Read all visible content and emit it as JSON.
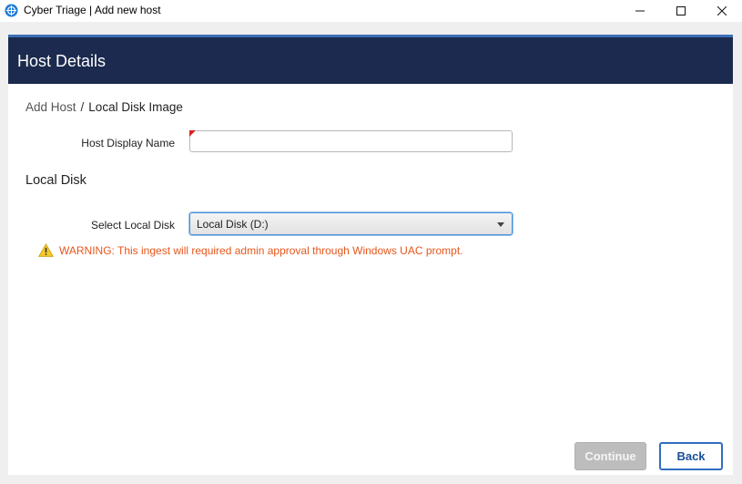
{
  "window": {
    "title": "Cyber Triage | Add new host",
    "app_icon": "cyber-triage-logo-icon",
    "controls": [
      "minimize-icon",
      "maximize-icon",
      "close-icon"
    ]
  },
  "header": {
    "title": "Host Details",
    "background": "#1b2a4e",
    "accent": "#3c6fb5"
  },
  "breadcrumb": {
    "root": "Add Host",
    "separator": "/",
    "current": "Local Disk Image"
  },
  "host": {
    "label": "Host Display Name",
    "value": "",
    "required": true
  },
  "local_disk": {
    "section_title": "Local Disk",
    "label": "Select Local Disk",
    "selected": "Local Disk (D:)"
  },
  "warning": {
    "icon": "warning-icon",
    "text": "WARNING: This ingest will required admin approval through Windows UAC prompt.",
    "color": "#e6561c"
  },
  "buttons": {
    "continue_label": "Continue",
    "continue_disabled": true,
    "back_label": "Back"
  }
}
